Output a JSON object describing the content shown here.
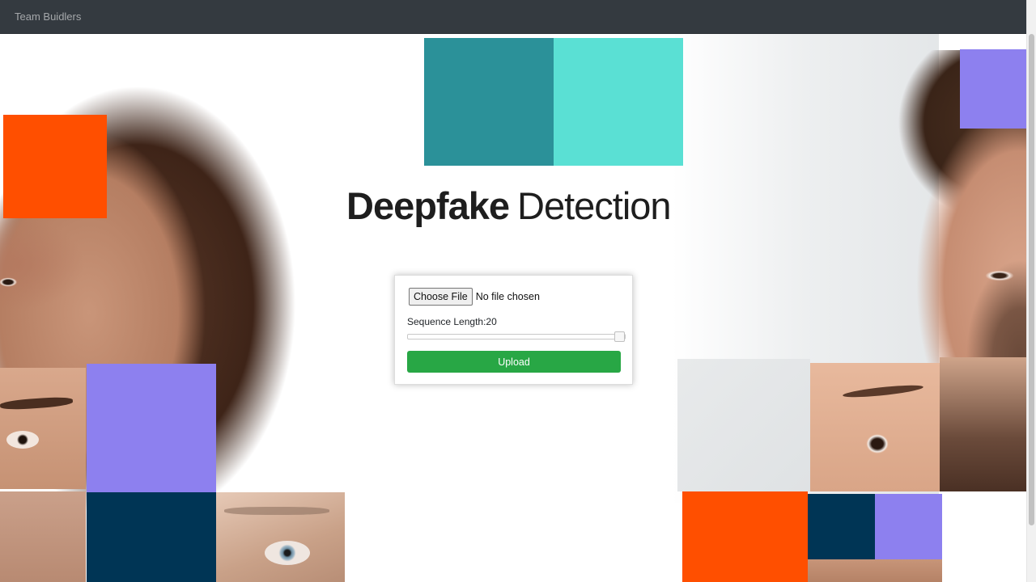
{
  "navbar": {
    "brand": "Team Buidlers"
  },
  "hero": {
    "title_bold": "Deepfake",
    "title_light": "Detection"
  },
  "form": {
    "choose_file_label": "Choose File",
    "no_file_text": "No file chosen",
    "sequence_label": "Sequence Length:",
    "sequence_value": "20",
    "sequence_fraction": 1.0,
    "upload_label": "Upload"
  },
  "colors": {
    "navbar": "#343a40",
    "teal_dark": "#2b9199",
    "teal_light": "#5ae0d4",
    "orange": "#ff4f00",
    "violet": "#8d80ef",
    "navy": "#003555",
    "upload_green": "#28a745"
  }
}
